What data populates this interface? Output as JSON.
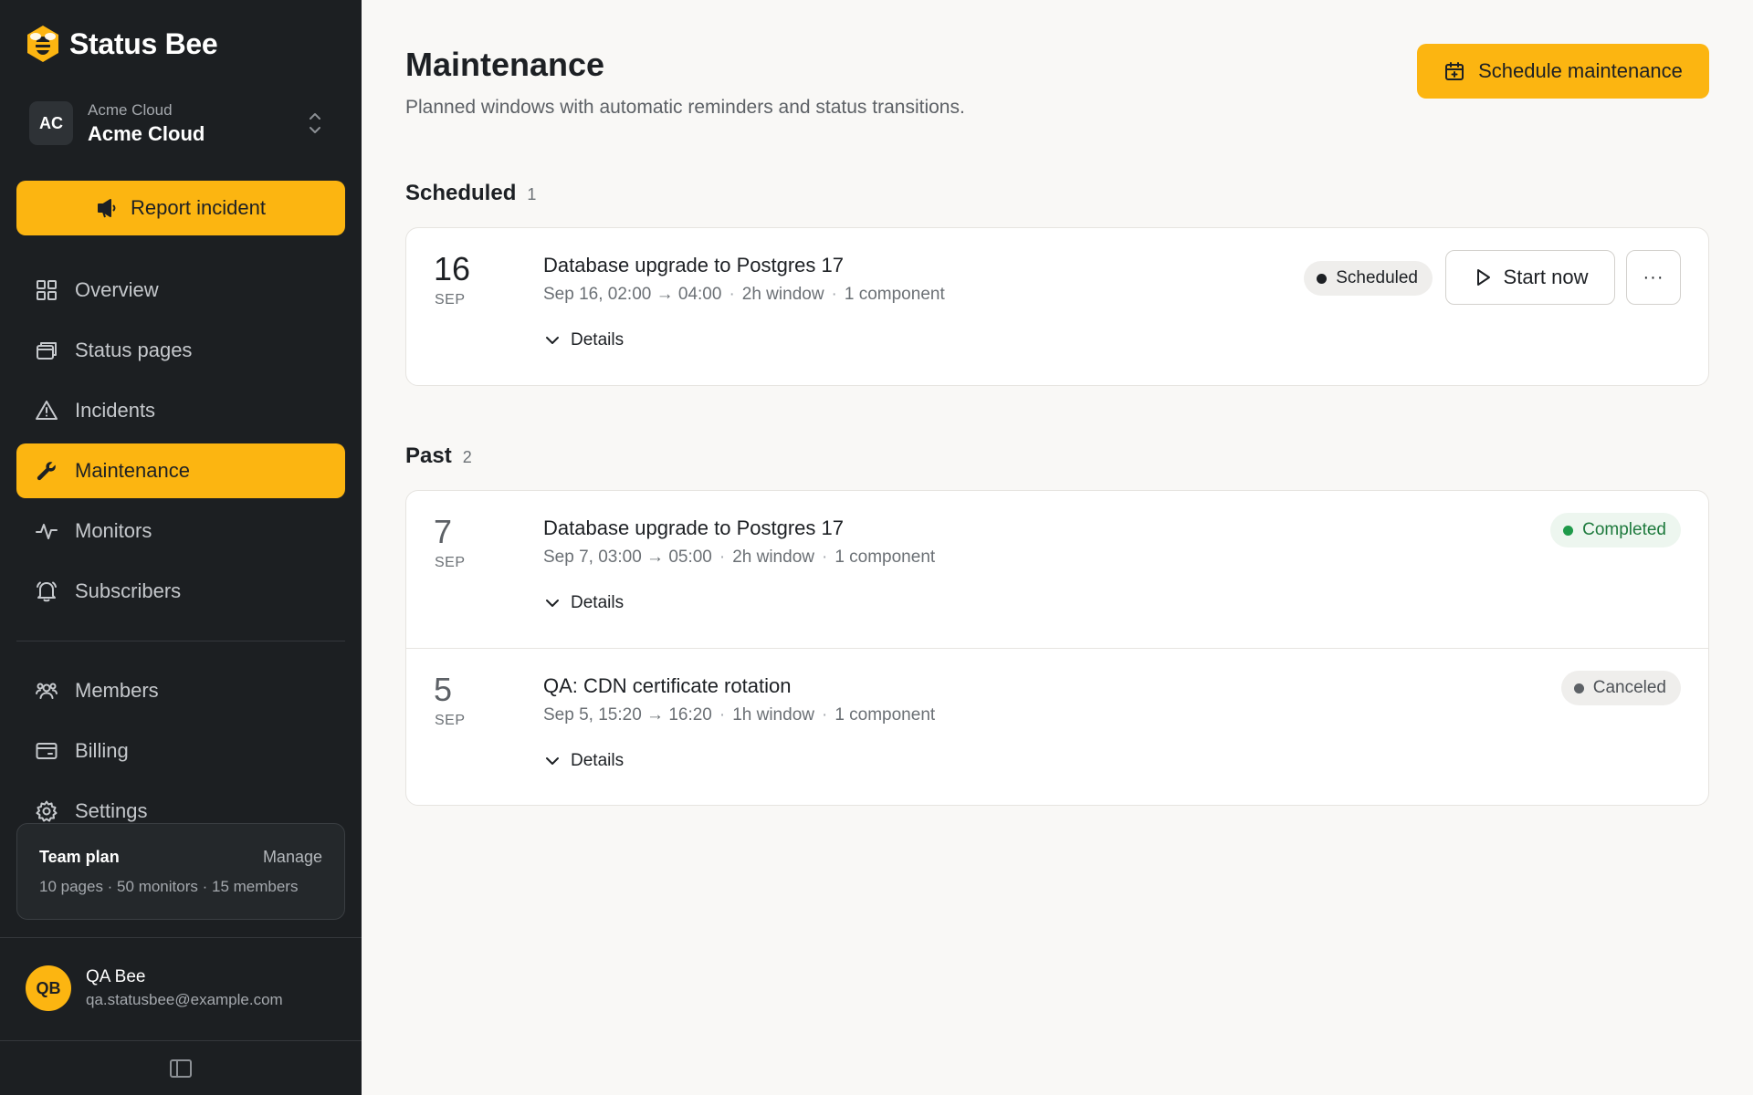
{
  "brand": {
    "name": "Status Bee"
  },
  "org": {
    "initials": "AC",
    "subtitle": "Acme Cloud",
    "name": "Acme Cloud"
  },
  "report_button": {
    "label": "Report incident"
  },
  "nav": {
    "overview": "Overview",
    "status_pages": "Status pages",
    "incidents": "Incidents",
    "maintenance": "Maintenance",
    "monitors": "Monitors",
    "subscribers": "Subscribers",
    "members": "Members",
    "billing": "Billing",
    "settings": "Settings"
  },
  "plan": {
    "title": "Team plan",
    "manage": "Manage",
    "details": "10 pages · 50 monitors · 15 members"
  },
  "user": {
    "initials": "QB",
    "name": "QA Bee",
    "email": "qa.statusbee@example.com"
  },
  "page": {
    "title": "Maintenance",
    "subtitle": "Planned windows with automatic reminders and status transitions.",
    "schedule_button": "Schedule maintenance"
  },
  "scheduled": {
    "title": "Scheduled",
    "count": "1",
    "items": [
      {
        "day": "16",
        "month": "SEP",
        "title": "Database upgrade to Postgres 17",
        "time": "Sep 16, 02:00 → 04:00",
        "window": "2h window",
        "components": "1 component",
        "details": "Details",
        "status": "Scheduled",
        "start_label": "Start now",
        "more_label": "···"
      }
    ]
  },
  "past": {
    "title": "Past",
    "count": "2",
    "items": [
      {
        "day": "7",
        "month": "SEP",
        "title": "Database upgrade to Postgres 17",
        "time": "Sep 7, 03:00 → 05:00",
        "window": "2h window",
        "components": "1 component",
        "details": "Details",
        "status": "Completed"
      },
      {
        "day": "5",
        "month": "SEP",
        "title": "QA: CDN certificate rotation",
        "time": "Sep 5, 15:20 → 16:20",
        "window": "1h window",
        "components": "1 component",
        "details": "Details",
        "status": "Canceled"
      }
    ]
  },
  "colors": {
    "accent": "#fcb511",
    "sidebar": "#1c1f22",
    "success": "#1f9a4a"
  }
}
